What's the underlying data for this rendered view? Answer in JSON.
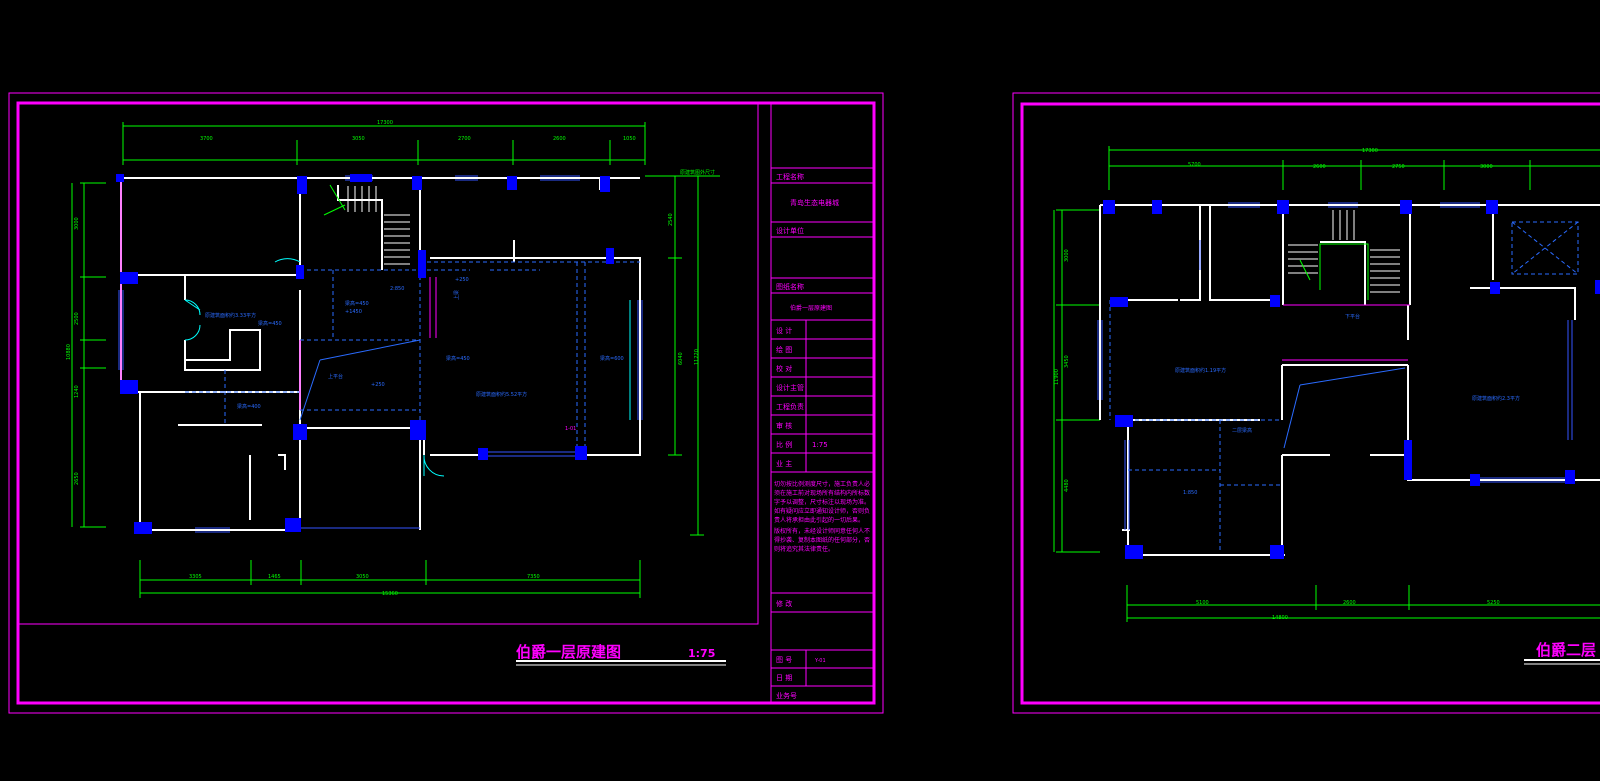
{
  "colors": {
    "background": "#000000",
    "frame": "#ff00ff",
    "wall": "#ffffff",
    "column": "#0000ff",
    "dimension": "#00ff00",
    "dashed": "#2a6bff",
    "cyan": "#00ffff"
  },
  "sheet1": {
    "title": "伯爵一层原建图",
    "scale": "1:75",
    "titleblock": {
      "project_label": "工程名称",
      "project_value": "青岛生态电器城",
      "design_unit_label": "设计单位",
      "drawing_name_label": "图纸名称",
      "drawing_name_value": "伯爵一层原建图",
      "rows": [
        {
          "label": "设  计",
          "value": ""
        },
        {
          "label": "绘  图",
          "value": ""
        },
        {
          "label": "校  对",
          "value": ""
        },
        {
          "label": "设计主管",
          "value": ""
        },
        {
          "label": "工程负责",
          "value": ""
        },
        {
          "label": "审  核",
          "value": ""
        },
        {
          "label": "比  例",
          "value": "1:75"
        },
        {
          "label": "业  主",
          "value": ""
        }
      ],
      "notes_1": "切勿按比例测度尺寸，施工负责人必须在施工前对现场所有结构内所标数字予以调整，尺寸标注以现场为准。如有疑问应立即通知设计师，否则负责人将承担由此引起的一切后果。",
      "notes_2": "版权所有，未经设计师同意任何人不得抄袭、复制本图纸的任何部分，否则将追究其法律责任。",
      "revise_label": "修  改",
      "drawing_no_label": "图  号",
      "drawing_no_value": "Y-01",
      "date_label": "日  期",
      "job_no_label": "业务号"
    },
    "dims_top_total": "17300",
    "dims_top": [
      "3700",
      "3050",
      "2700",
      "2600",
      "1050"
    ],
    "dims_left": [
      "3000",
      "2500",
      "1240",
      "2650"
    ],
    "dims_left_total": "10880",
    "dims_bottom": [
      "3305",
      "1465",
      "3050",
      "7350"
    ],
    "dims_bottom_total": "15360",
    "dims_right": [
      "2540",
      "6040",
      "11220"
    ],
    "top_right_note": "原建筑图外尺寸",
    "room_labels": [
      "原建筑面积约3.33平方",
      "原建筑面积约5.52平方",
      "上平台",
      "+250",
      "+250",
      "梁高=450",
      "梁高=450",
      "梁高=450",
      "梁高=600",
      "梁高=400",
      "上梁",
      "2:850",
      "+1450",
      "1-01"
    ]
  },
  "sheet2": {
    "title": "伯爵二层",
    "dims_top_total": "17300",
    "dims_top": [
      "5700",
      "2600",
      "2750",
      "3000"
    ],
    "dims_left": [
      "3000",
      "3450",
      "4480"
    ],
    "dims_left_total": "11900",
    "dims_bottom": [
      "5100",
      "2600",
      "5250"
    ],
    "dims_bottom_total": "14800",
    "room_labels": [
      "原建筑面积约1.19平方",
      "原建筑面积约2.3平方",
      "下平台",
      "1:850",
      "二层梁高"
    ]
  }
}
